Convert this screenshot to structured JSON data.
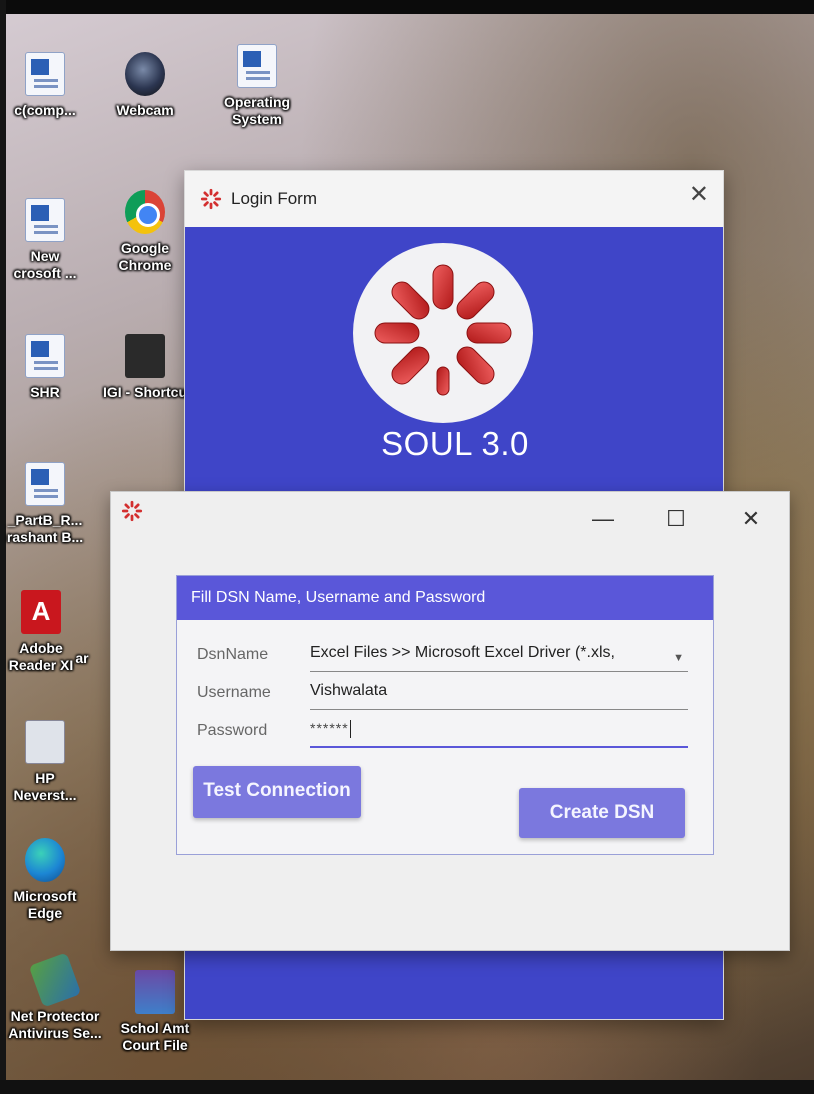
{
  "desktop": {
    "icons": [
      {
        "label": "c(comp...",
        "icon": "word-doc-icon"
      },
      {
        "label": "Webcam",
        "icon": "webcam-icon"
      },
      {
        "label": "Operating\nSystem",
        "icon": "word-doc-icon"
      },
      {
        "label": "New\ncrosoft ...",
        "icon": "word-doc-icon"
      },
      {
        "label": "Google\nChrome",
        "icon": "chrome-icon"
      },
      {
        "label": "SHR",
        "icon": "word-doc-icon"
      },
      {
        "label": "IGI - Shortcu",
        "icon": "igi-shortcut-icon"
      },
      {
        "label": "_PartB_R...\nrashant B...",
        "icon": "word-doc-icon"
      },
      {
        "label": "Adobe\nReader XI",
        "icon": "adobe-reader-icon"
      },
      {
        "label": "ar",
        "icon": "app-icon"
      },
      {
        "label": "HP\nNeverst...",
        "icon": "printer-icon"
      },
      {
        "label": "Microsoft\nEdge",
        "icon": "edge-icon"
      },
      {
        "label": "Net Protector\nAntivirus Se...",
        "icon": "antivirus-icon"
      },
      {
        "label": "Schol Amt\nCourt File",
        "icon": "winrar-icon"
      }
    ]
  },
  "login_window": {
    "title": "Login Form",
    "close_glyph": "✕",
    "app_name": "SOUL 3.0",
    "logo_color": "#d32f2f",
    "background": "#3f45c8"
  },
  "dsn_dialog": {
    "window_buttons": {
      "minimize": "—",
      "maximize": "☐",
      "close": "✕"
    },
    "panel_header": "Fill DSN Name, Username and Password",
    "fields": {
      "dsn_label": "DsnName",
      "dsn_value": "Excel Files >> Microsoft Excel Driver (*.xls,",
      "username_label": "Username",
      "username_value": "Vishwalata",
      "password_label": "Password",
      "password_value": "******"
    },
    "buttons": {
      "test_connection": "Test Connection",
      "create_dsn": "Create DSN"
    },
    "accent": "#5a57d9"
  }
}
